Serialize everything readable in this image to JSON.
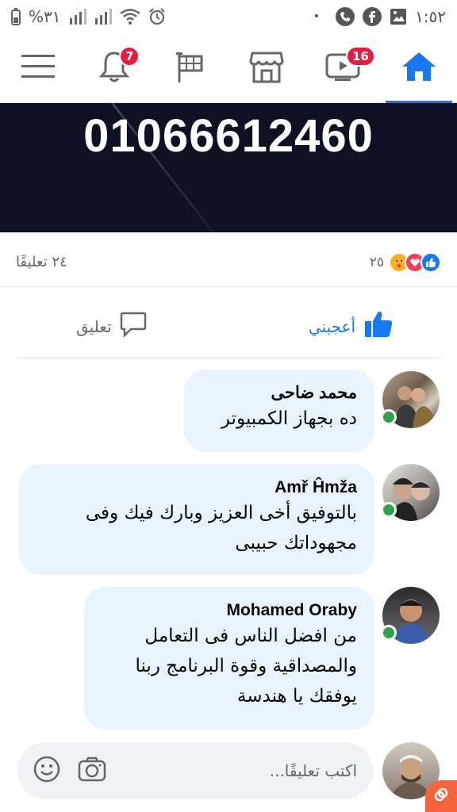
{
  "status_bar": {
    "battery": "%٣١",
    "time": "١:٥٢",
    "dot": "•"
  },
  "nav": {
    "notifications_badge": "7",
    "watch_badge": "16",
    "items": [
      "menu-icon",
      "bell-icon",
      "flag-icon",
      "marketplace-icon",
      "watch-icon",
      "home-icon"
    ],
    "active": "home",
    "accent": "#1877f2",
    "badge_color": "#e41e3f"
  },
  "post": {
    "image_text": "01066612460",
    "reactions_count": "٢٥",
    "comments_count": "٢٤ تعليقًا",
    "reaction_icons": [
      "like-icon",
      "love-icon",
      "care-icon"
    ]
  },
  "actions": {
    "like_label": "أعجبني",
    "comment_label": "تعليق"
  },
  "comments": [
    {
      "author": "محمد ضاحى",
      "text": "ده بجهاز الكمبيوتر",
      "online": true
    },
    {
      "author": "Amř Ĥmža",
      "text_lines": [
        "بالتوفيق أخى العزيز وبارك فيك وفى",
        "مجهوداتك حبيبى"
      ],
      "online": true
    },
    {
      "author": "Mohamed Oraby",
      "text_lines": [
        "من افضل الناس فى التعامل",
        "والمصداقية وقوة البرنامج ربنا",
        "يوفقك يا هندسة"
      ],
      "online": true
    }
  ],
  "composer": {
    "placeholder": "اكتب تعليقًا..."
  }
}
